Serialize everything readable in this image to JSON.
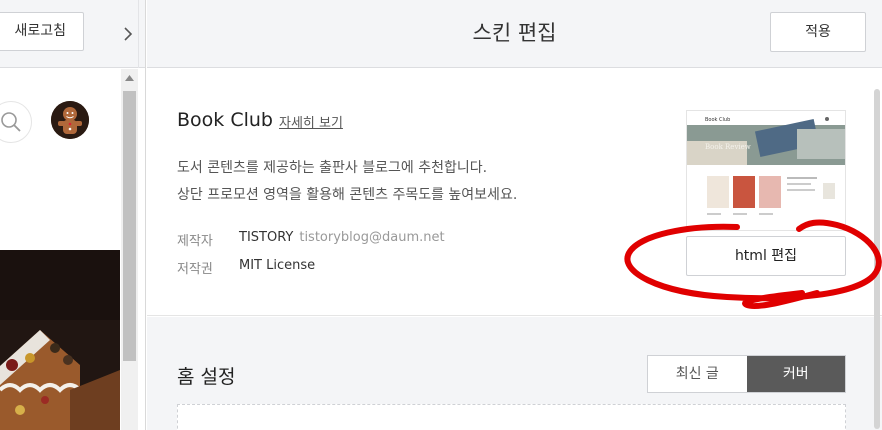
{
  "left_panel": {
    "refresh_label": "새로고침",
    "collapse_icon": "chevron-right-icon",
    "search_icon": "search-icon",
    "avatar_icon": "gingerbread-avatar"
  },
  "header": {
    "title": "스킨 편집",
    "apply_label": "적용"
  },
  "skin": {
    "name": "Book Club",
    "detail_link": "자세히 보기",
    "description_line1": "도서 콘텐츠를 제공하는 출판사 블로그에 추천합니다.",
    "description_line2": "상단 프로모션 영역을 활용해 콘텐츠 주목도를 높여보세요.",
    "maker_label": "제작자",
    "maker_name": "TISTORY",
    "maker_email": "tistoryblog@daum.net",
    "license_label": "저작권",
    "license_value": "MIT License",
    "html_edit_label": "html 편집",
    "thumb_title": "Book Club",
    "thumb_banner": "Book Review"
  },
  "home_settings": {
    "title": "홈 설정",
    "options": [
      "최신 글",
      "커버"
    ],
    "selected": "커버"
  },
  "colors": {
    "annotation": "#e00000",
    "toggle_active": "#5a5a5a",
    "toolbar_bg": "#f4f5f7"
  }
}
